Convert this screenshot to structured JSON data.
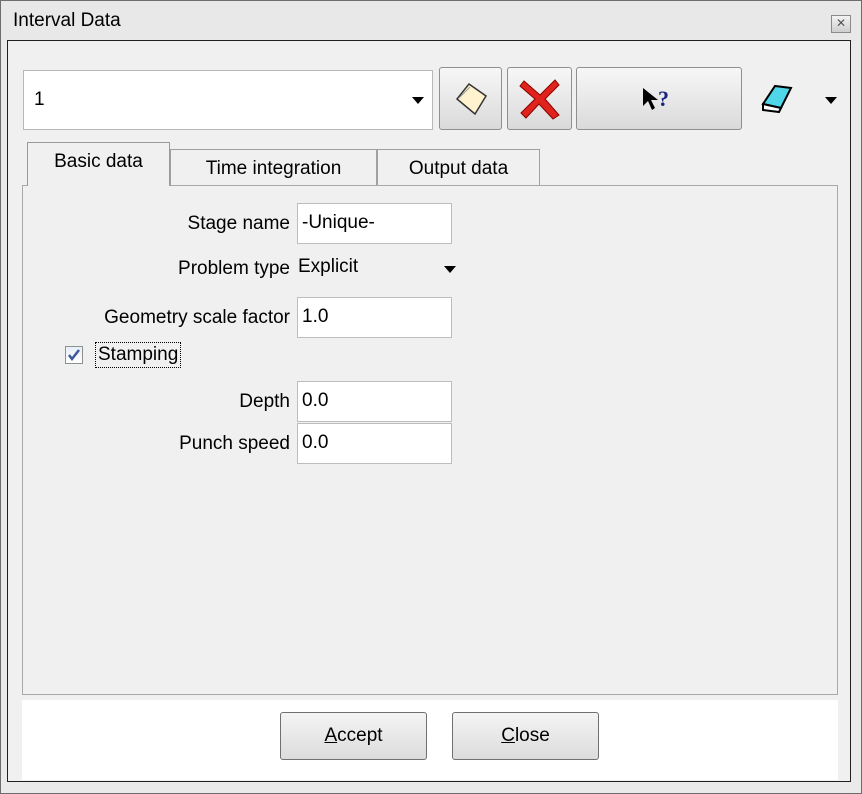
{
  "window": {
    "title": "Interval Data"
  },
  "toolbar": {
    "combo_value": "1",
    "new_icon": "new-sheet-icon",
    "delete_icon": "red-x-delete-icon",
    "help_label": "?",
    "help_icon": "pointer-help-icon",
    "eraser_icon": "eraser-icon",
    "menu_icon": "chevron-down-icon"
  },
  "tabs": [
    {
      "label": "Basic data",
      "active": true
    },
    {
      "label": "Time integration",
      "active": false
    },
    {
      "label": "Output data",
      "active": false
    }
  ],
  "form": {
    "stage_name_label": "Stage name",
    "stage_name_value": "-Unique-",
    "problem_type_label": "Problem type",
    "problem_type_value": "Explicit",
    "geometry_scale_label": "Geometry scale factor",
    "geometry_scale_value": "1.0",
    "stamping_label": "Stamping",
    "stamping_checked": true,
    "depth_label": "Depth",
    "depth_value": "0.0",
    "punch_speed_label": "Punch speed",
    "punch_speed_value": "0.0"
  },
  "buttons": {
    "accept_prefix": "A",
    "accept_rest": "ccept",
    "close_prefix": "C",
    "close_rest": "lose"
  },
  "colors": {
    "delete_red": "#e0231d",
    "check_blue": "#3b5998",
    "eraser_cyan": "#4fd6e8"
  }
}
